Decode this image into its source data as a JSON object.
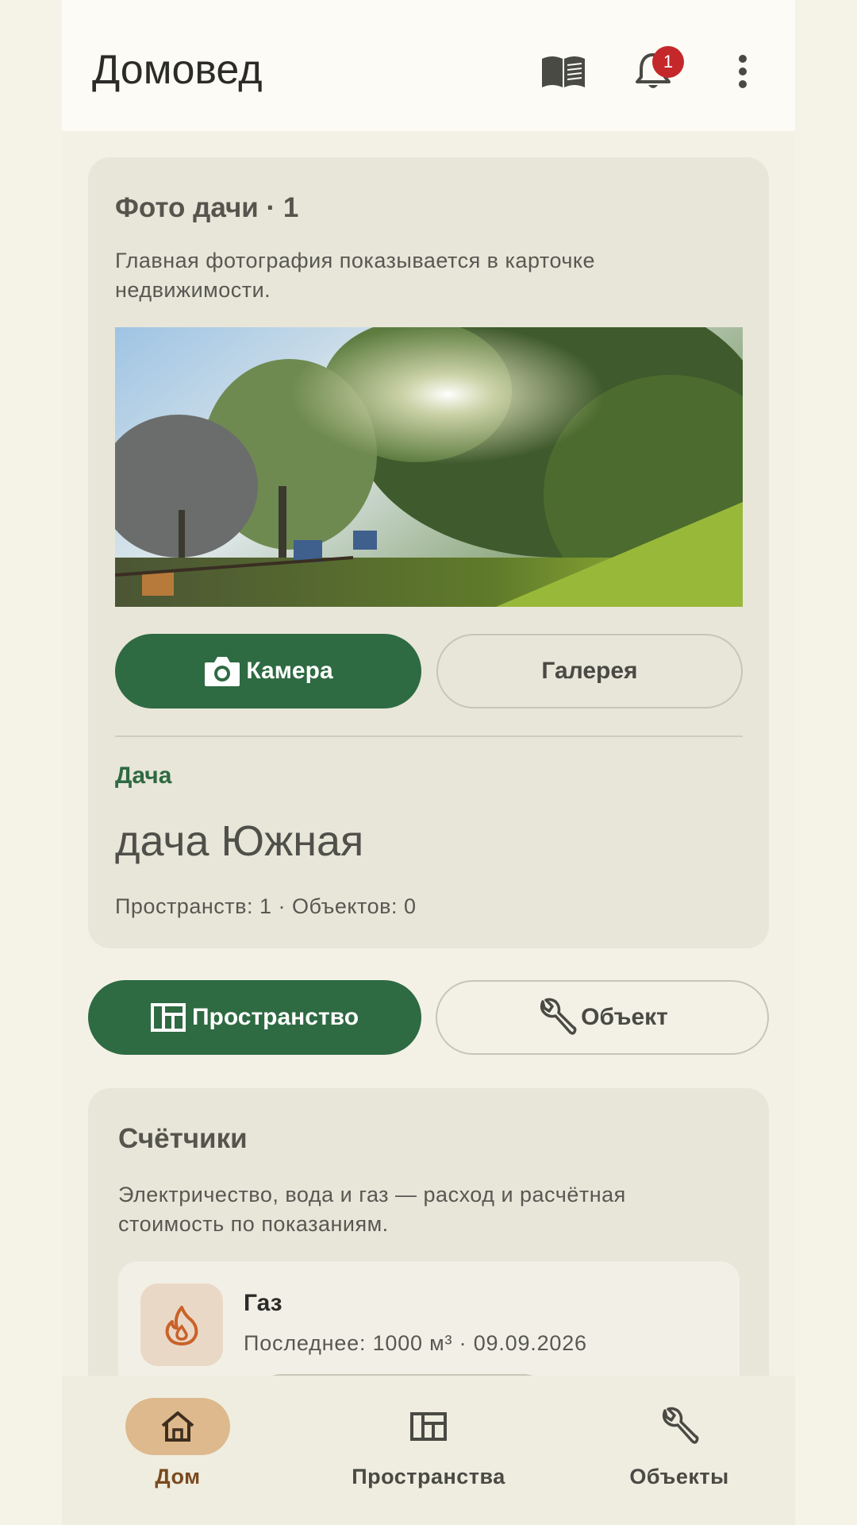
{
  "app": {
    "title": "Домовед",
    "notification_count": "1"
  },
  "photo_card": {
    "title": "Фото дачи · 1",
    "subtitle": "Главная фотография показывается в карточке недвижимости.",
    "camera_label": "Камера",
    "gallery_label": "Галерея"
  },
  "property": {
    "type": "Дача",
    "name": "дача Южная",
    "stats": "Пространств: 1 · Объектов: 0"
  },
  "actions": {
    "space_label": "Пространство",
    "object_label": "Объект"
  },
  "meters": {
    "title": "Счётчики",
    "subtitle": "Электричество, вода и газ — расход и расчётная стоимость по показаниям.",
    "items": [
      {
        "name": "Газ",
        "last": "Последнее: 1000 м³ · 09.09.2026",
        "icon": "flame-icon"
      }
    ]
  },
  "nav": {
    "items": [
      {
        "label": "Дом",
        "icon": "home-icon",
        "active": true
      },
      {
        "label": "Пространства",
        "icon": "floorplan-icon",
        "active": false
      },
      {
        "label": "Объекты",
        "icon": "wrench-icon",
        "active": false
      }
    ]
  },
  "colors": {
    "primary": "#2e6a42",
    "accent": "#ddb98d",
    "badge": "#c4282a"
  }
}
